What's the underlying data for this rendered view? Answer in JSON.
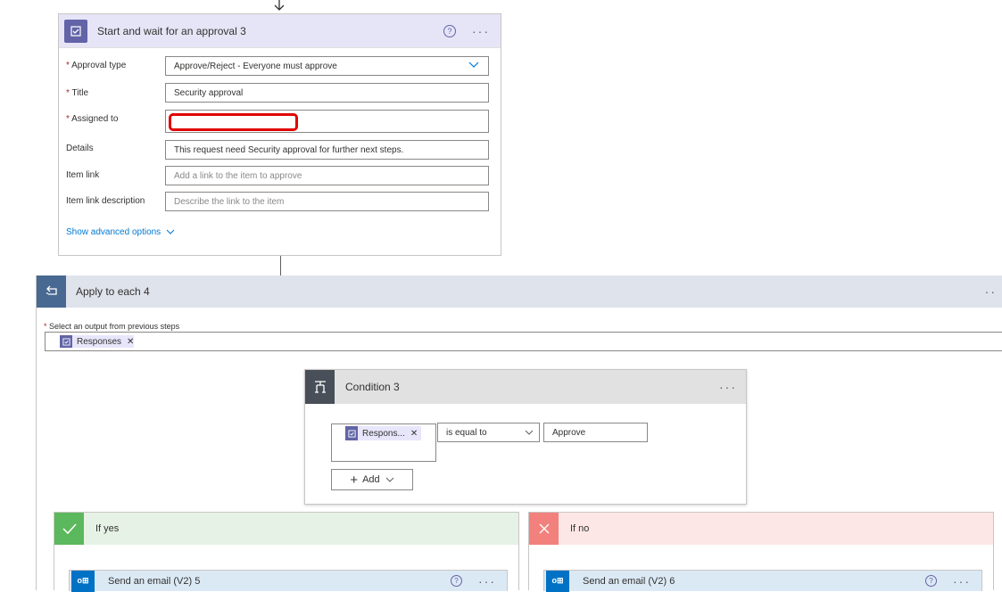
{
  "approval": {
    "title": "Start and wait for an approval 3",
    "fields": {
      "approval_type": {
        "label": "Approval type",
        "value": "Approve/Reject - Everyone must approve"
      },
      "title": {
        "label": "Title",
        "value": "Security approval"
      },
      "assigned_to": {
        "label": "Assigned to",
        "value": ""
      },
      "details": {
        "label": "Details",
        "value": "This request need Security approval for further next steps."
      },
      "item_link": {
        "label": "Item link",
        "placeholder": "Add a link to the item to approve"
      },
      "item_link_description": {
        "label": "Item link description",
        "placeholder": "Describe the link to the item"
      }
    },
    "advanced_label": "Show advanced options"
  },
  "apply_each": {
    "title": "Apply to each 4",
    "select_label": "Select an output from previous steps",
    "token": "Responses"
  },
  "condition": {
    "title": "Condition 3",
    "left_token": "Respons...",
    "operator": "is equal to",
    "right_value": "Approve",
    "add_label": "Add"
  },
  "branches": {
    "yes": {
      "label": "If yes",
      "action_title": "Send an email (V2) 5"
    },
    "no": {
      "label": "If no",
      "action_title": "Send an email (V2) 6"
    }
  },
  "colors": {
    "approval_accent": "#6264a7",
    "approval_header": "#e6e5f7",
    "loop_header": "#dfe3eb",
    "loop_icon": "#486991",
    "condition_icon": "#484f58",
    "yes_green": "#5cb85c",
    "no_red": "#f2817d",
    "outlook_blue": "#0072c6",
    "annotation_red": "#e00000"
  }
}
